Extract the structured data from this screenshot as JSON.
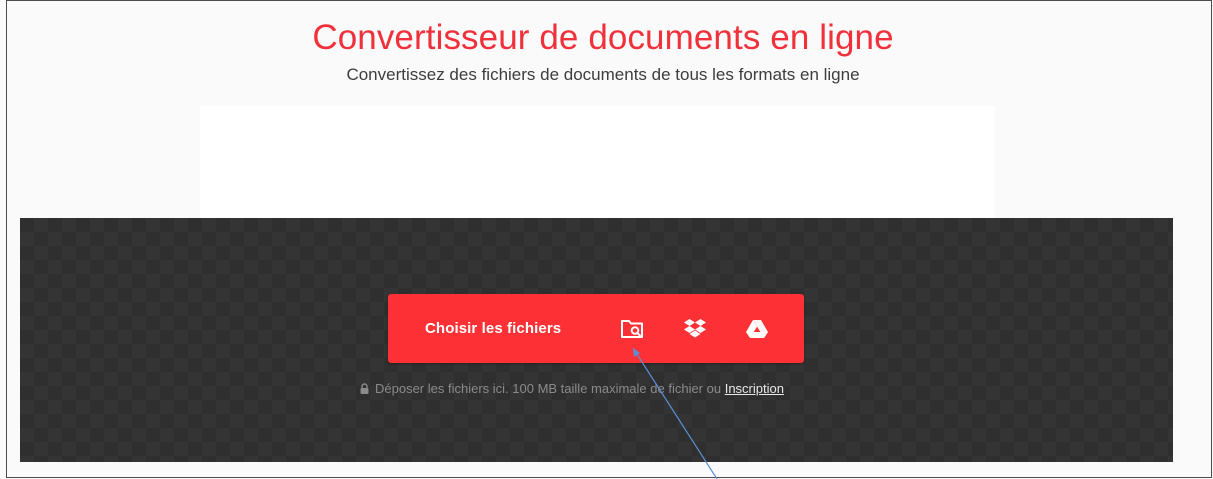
{
  "header": {
    "title": "Convertisseur de documents en ligne",
    "subtitle": "Convertissez des fichiers de documents de tous les formats en ligne"
  },
  "upload": {
    "choose_label": "Choisir les fichiers",
    "sources": [
      {
        "name": "folder-search-icon"
      },
      {
        "name": "dropbox-icon"
      },
      {
        "name": "google-drive-icon"
      }
    ],
    "note_text": "Déposer les fichiers ici. 100 MB taille maximale de fichier ou ",
    "signup_link": "Inscription"
  },
  "colors": {
    "brand_red": "#fc3035",
    "title_red": "#f0303a",
    "dropzone_bg": "#2f2f2f",
    "annotation_arrow": "#5b8fd6"
  }
}
